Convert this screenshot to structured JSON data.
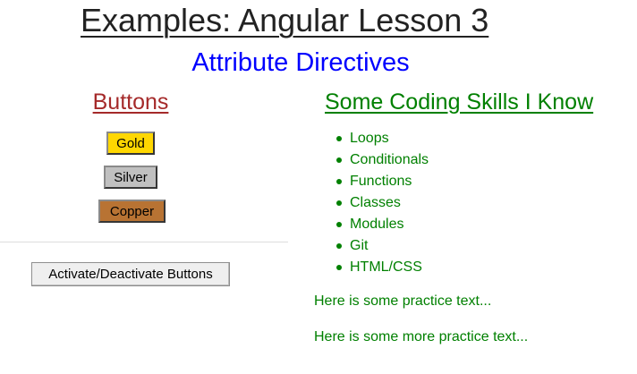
{
  "header": {
    "title": "Examples: Angular Lesson 3",
    "subtitle": "Attribute Directives"
  },
  "buttons_panel": {
    "heading": "Buttons",
    "buttons": [
      {
        "label": "Gold",
        "color": "#ffd700"
      },
      {
        "label": "Silver",
        "color": "#c0c0c0"
      },
      {
        "label": "Copper",
        "color": "#b87333"
      }
    ],
    "toggle_label": "Activate/Deactivate Buttons"
  },
  "skills_panel": {
    "heading": "Some Coding Skills I Know",
    "skills": [
      "Loops",
      "Conditionals",
      "Functions",
      "Classes",
      "Modules",
      "Git",
      "HTML/CSS"
    ],
    "practice_texts": [
      "Here is some practice text...",
      "Here is some more practice text..."
    ]
  },
  "colors": {
    "title": "#222222",
    "subtitle": "#0000ff",
    "buttons_heading": "#a52a2a",
    "skills_text": "#008000"
  }
}
